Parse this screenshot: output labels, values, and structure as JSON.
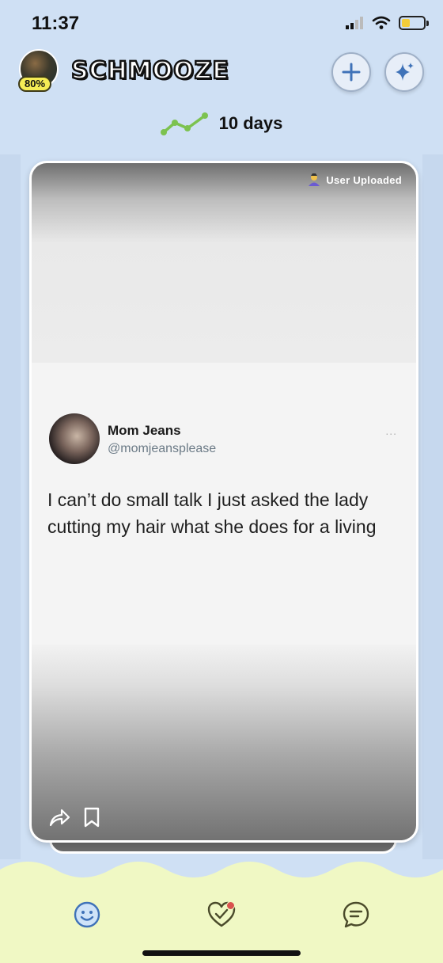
{
  "status_bar": {
    "time": "11:37"
  },
  "header": {
    "brand": "SCHMOOZE",
    "profile_percent": "80%"
  },
  "streak": {
    "label": "10 days"
  },
  "card": {
    "source_label": "User Uploaded",
    "tweet": {
      "name": "Mom Jeans",
      "handle": "@momjeansplease",
      "more": "...",
      "text": "I can’t do small talk I just asked the lady cutting my hair what she does for a living"
    }
  },
  "colors": {
    "background": "#cfe0f4",
    "bottom_nav": "#f0f8c4",
    "streak_green": "#7cc24f",
    "accent_blue": "#3f72b8",
    "notification": "#d9534f"
  },
  "icons": {
    "add": "plus-icon",
    "sparkle": "sparkle-icon",
    "streak": "trend-line-icon",
    "share": "share-icon",
    "bookmark": "bookmark-icon",
    "nav_face": "smiley-icon",
    "nav_heart": "heart-icon",
    "nav_chat": "chat-icon"
  }
}
